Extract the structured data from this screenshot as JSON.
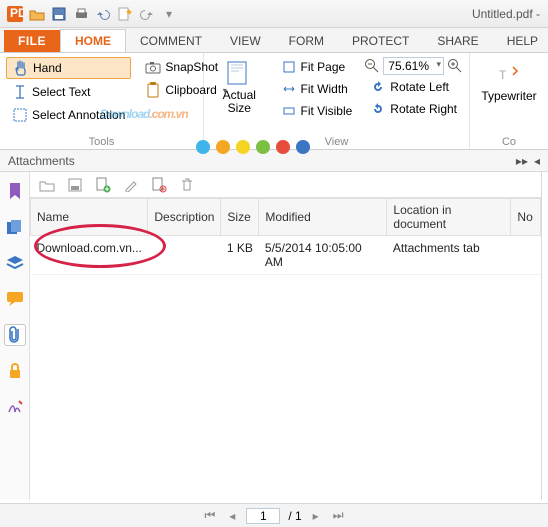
{
  "window": {
    "title": "Untitled.pdf -"
  },
  "tabs": {
    "file": "FILE",
    "home": "HOME",
    "comment": "COMMENT",
    "view": "VIEW",
    "form": "FORM",
    "protect": "PROTECT",
    "share": "SHARE",
    "help": "HELP"
  },
  "ribbon": {
    "tools": {
      "hand": "Hand",
      "select_text": "Select Text",
      "select_annotation": "Select Annotation",
      "snapshot": "SnapShot",
      "clipboard": "Clipboard",
      "group_label": "Tools"
    },
    "view": {
      "actual_size": "Actual Size",
      "fit_page": "Fit Page",
      "fit_width": "Fit Width",
      "fit_visible": "Fit Visible",
      "zoom": "75.61%",
      "rotate_left": "Rotate Left",
      "rotate_right": "Rotate Right",
      "group_label": "View"
    },
    "typewriter": "Typewriter",
    "co": "Co"
  },
  "panel": {
    "title": "Attachments"
  },
  "columns": {
    "name": "Name",
    "description": "Description",
    "size": "Size",
    "modified": "Modified",
    "location": "Location in document",
    "no": "No"
  },
  "rows": [
    {
      "name": "Download.com.vn...",
      "description": "",
      "size": "1 KB",
      "modified": "5/5/2014 10:05:00 AM",
      "location": "Attachments tab"
    }
  ],
  "pager": {
    "value": "1",
    "total": "/ 1"
  },
  "watermark": {
    "main": "Download",
    "ext": ".com.vn"
  }
}
